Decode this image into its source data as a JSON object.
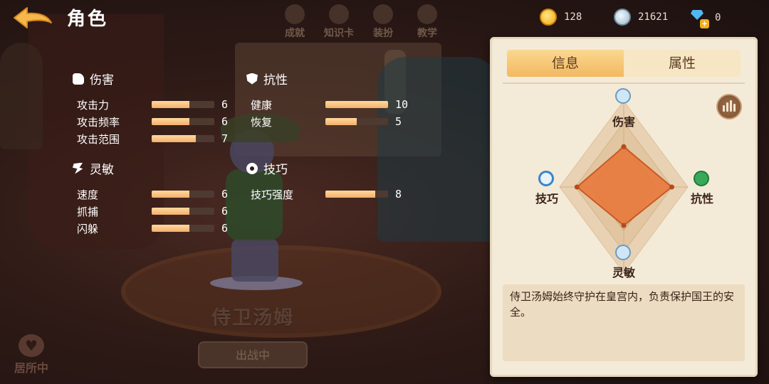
{
  "header": {
    "title": "角色",
    "tabs": [
      {
        "label": "成就",
        "icon": "trophy-icon"
      },
      {
        "label": "知识卡",
        "icon": "card-icon"
      },
      {
        "label": "装扮",
        "icon": "outfit-icon"
      },
      {
        "label": "教学",
        "icon": "book-icon"
      }
    ]
  },
  "currency": {
    "gold": "128",
    "silver": "21621",
    "gems": "0"
  },
  "stats": {
    "damage": {
      "title": "伤害",
      "rows": [
        {
          "label": "攻击力",
          "value": "6",
          "fill": 0.6
        },
        {
          "label": "攻击频率",
          "value": "6",
          "fill": 0.6
        },
        {
          "label": "攻击范围",
          "value": "7",
          "fill": 0.7
        }
      ]
    },
    "resist": {
      "title": "抗性",
      "rows": [
        {
          "label": "健康",
          "value": "10",
          "fill": 1.0
        },
        {
          "label": "恢复",
          "value": "5",
          "fill": 0.5
        }
      ]
    },
    "agility": {
      "title": "灵敏",
      "rows": [
        {
          "label": "速度",
          "value": "6",
          "fill": 0.6
        },
        {
          "label": "抓捕",
          "value": "6",
          "fill": 0.6
        },
        {
          "label": "闪躲",
          "value": "6",
          "fill": 0.6
        }
      ]
    },
    "skill": {
      "title": "技巧",
      "rows": [
        {
          "label": "技巧强度",
          "value": "8",
          "fill": 0.8
        }
      ]
    }
  },
  "character": {
    "name": "侍卫汤姆",
    "deploy_label": "出战中",
    "home_label": "居所中"
  },
  "panel": {
    "tab_info": "信息",
    "tab_attributes": "属性",
    "radar": {
      "top": "伤害",
      "right": "抗性",
      "bottom": "灵敏",
      "left": "技巧",
      "values": {
        "top": 0.63,
        "right": 0.75,
        "bottom": 0.6,
        "left": 0.73
      }
    },
    "description": "侍卫汤姆始终守护在皇宫内，负责保护国王的安全。"
  },
  "colors": {
    "bar_fill": "#f4b06a",
    "panel_bg": "#f4ead8",
    "tab_active": "#f2b860",
    "radar_fill": "#e8783a"
  }
}
